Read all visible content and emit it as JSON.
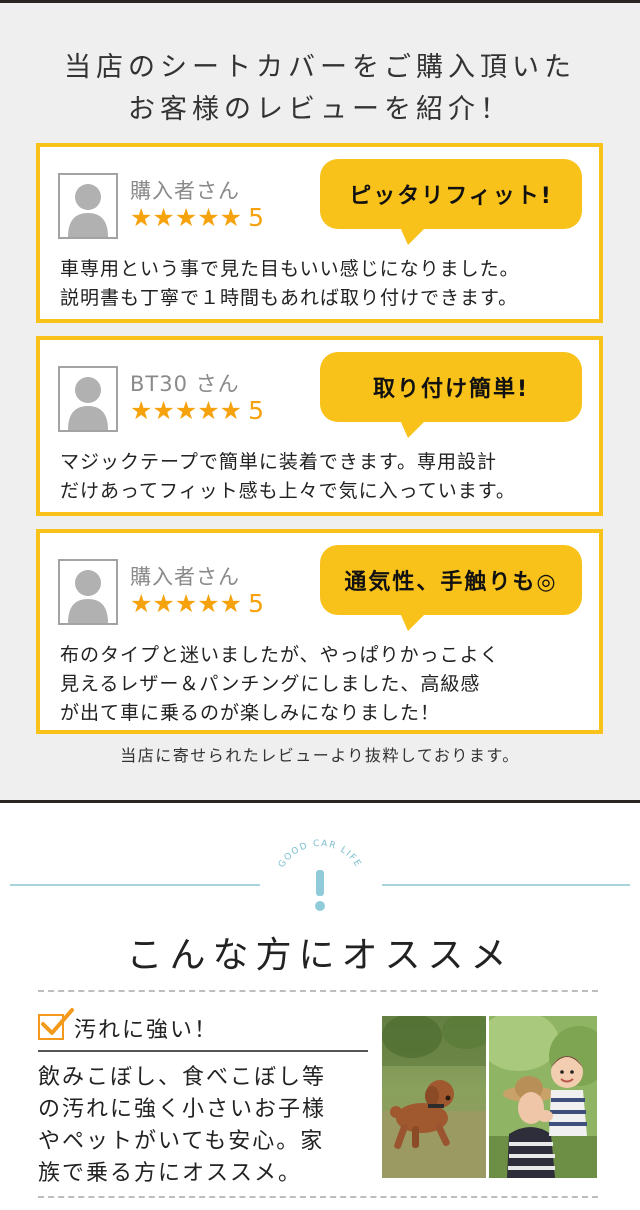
{
  "reviews": {
    "heading_line1": "当店のシートカバーをご購入頂いた",
    "heading_line2": "お客様のレビューを紹介！",
    "cards": [
      {
        "reviewer": "購入者さん",
        "stars": "★★★★★",
        "score": "5",
        "bubble": "ピッタリフィット!",
        "comment": [
          "車専用という事で見た目もいい感じになりました。",
          "説明書も丁寧で１時間もあれば取り付けできます。"
        ]
      },
      {
        "reviewer": "BT30 さん",
        "stars": "★★★★★",
        "score": "5",
        "bubble": "取り付け簡単!",
        "comment": [
          "マジックテープで簡単に装着できます。専用設計",
          "だけあってフィット感も上々で気に入っています。"
        ]
      },
      {
        "reviewer": "購入者さん",
        "stars": "★★★★★",
        "score": "5",
        "bubble": "通気性、手触りも◎",
        "comment": [
          "布のタイプと迷いましたが、やっぱりかっこよく",
          "見えるレザー＆パンチングにしました、高級感",
          "が出て車に乗るのが楽しみになりました！"
        ]
      }
    ],
    "note": "当店に寄せられたレビューより抜粋しております。"
  },
  "recommend": {
    "badge_text": "GOOD CAR LIFE",
    "badge_mark": "!",
    "title": "こんな方にオススメ",
    "item_title": "汚れに強い！",
    "item_text": [
      "飲みこぼし、食べこぼし等",
      "の汚れに強く小さいお子様",
      "やペットがいても安心。家",
      "族で乗る方にオススメ。"
    ]
  },
  "colors": {
    "accent_yellow": "#f8c21a",
    "star_orange": "#f6a20c",
    "check_orange": "#f39a1c",
    "divider_blue": "#a9d4de",
    "review_bg": "#efefef"
  },
  "icons": {
    "avatar": "person-placeholder-icon",
    "check": "checkbox-checked-icon",
    "badge": "exclamation-badge-icon"
  }
}
